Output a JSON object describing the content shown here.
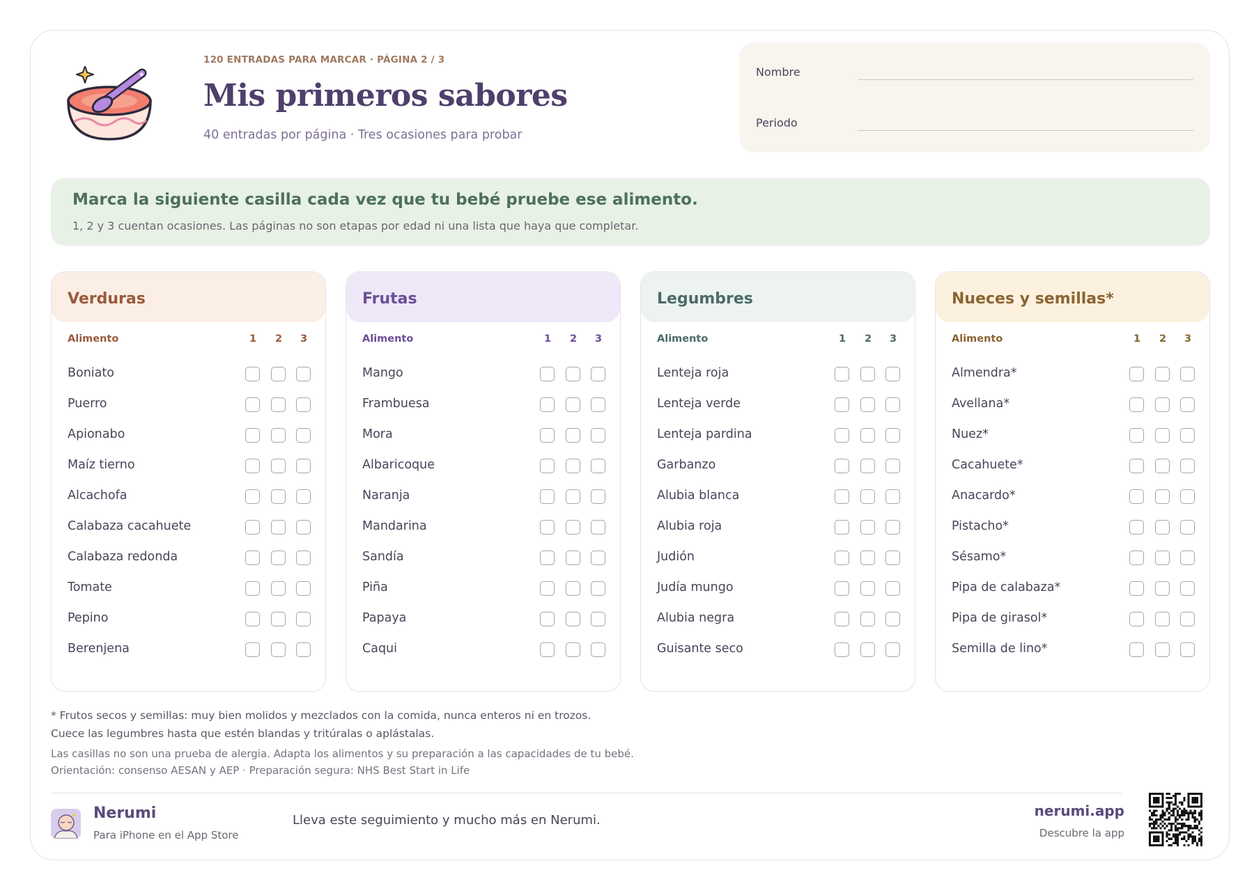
{
  "header": {
    "kicker": "120 ENTRADAS PARA MARCAR · PÁGINA 2 / 3",
    "title": "Mis primeros sabores",
    "subtitle": "40 entradas por página · Tres ocasiones para probar",
    "name_label": "Nombre",
    "period_label": "Periodo"
  },
  "banner": {
    "title": "Marca la siguiente casilla cada vez que tu bebé pruebe ese alimento.",
    "text": "1, 2 y 3 cuentan ocasiones. Las páginas no son etapas por edad ni una lista que haya que completar."
  },
  "categories": [
    {
      "title": "Verduras",
      "head_bg": "#fbeee5",
      "accent": "#9a5a3c",
      "col_label": "Alimento",
      "cols": [
        "1",
        "2",
        "3"
      ],
      "items": [
        "Boniato",
        "Puerro",
        "Apionabo",
        "Maíz tierno",
        "Alcachofa",
        "Calabaza cacahuete",
        "Calabaza redonda",
        "Tomate",
        "Pepino",
        "Berenjena"
      ]
    },
    {
      "title": "Frutas",
      "head_bg": "#efe8f8",
      "accent": "#6c4f96",
      "col_label": "Alimento",
      "cols": [
        "1",
        "2",
        "3"
      ],
      "items": [
        "Mango",
        "Frambuesa",
        "Mora",
        "Albaricoque",
        "Naranja",
        "Mandarina",
        "Sandía",
        "Piña",
        "Papaya",
        "Caqui"
      ]
    },
    {
      "title": "Legumbres",
      "head_bg": "#ecf3f0",
      "accent": "#4d6b68",
      "col_label": "Alimento",
      "cols": [
        "1",
        "2",
        "3"
      ],
      "items": [
        "Lenteja roja",
        "Lenteja verde",
        "Lenteja pardina",
        "Garbanzo",
        "Alubia blanca",
        "Alubia roja",
        "Judión",
        "Judía mungo",
        "Alubia negra",
        "Guisante seco"
      ]
    },
    {
      "title": "Nueces y semillas*",
      "head_bg": "#fbf1de",
      "accent": "#8a6533",
      "col_label": "Alimento",
      "cols": [
        "1",
        "2",
        "3"
      ],
      "items": [
        "Almendra*",
        "Avellana*",
        "Nuez*",
        "Cacahuete*",
        "Anacardo*",
        "Pistacho*",
        "Sésamo*",
        "Pipa de calabaza*",
        "Pipa de girasol*",
        "Semilla de lino*"
      ]
    }
  ],
  "notes": {
    "line1": "* Frutos secos y semillas: muy bien molidos y mezclados con la comida, nunca enteros ni en trozos.",
    "line2": "Cuece las legumbres hasta que estén blandas y tritúralas o aplástalas.",
    "line3": "Las casillas no son una prueba de alergia. Adapta los alimentos y su preparación a las capacidades de tu bebé.",
    "line4": "Orientación: consenso AESAN y AEP · Preparación segura: NHS Best Start in Life"
  },
  "footer": {
    "brand": "Nerumi",
    "brand_sub": "Para iPhone en el App Store",
    "promo": "Lleva este seguimiento y mucho más en Nerumi.",
    "url": "nerumi.app",
    "url_sub": "Descubre la app"
  }
}
